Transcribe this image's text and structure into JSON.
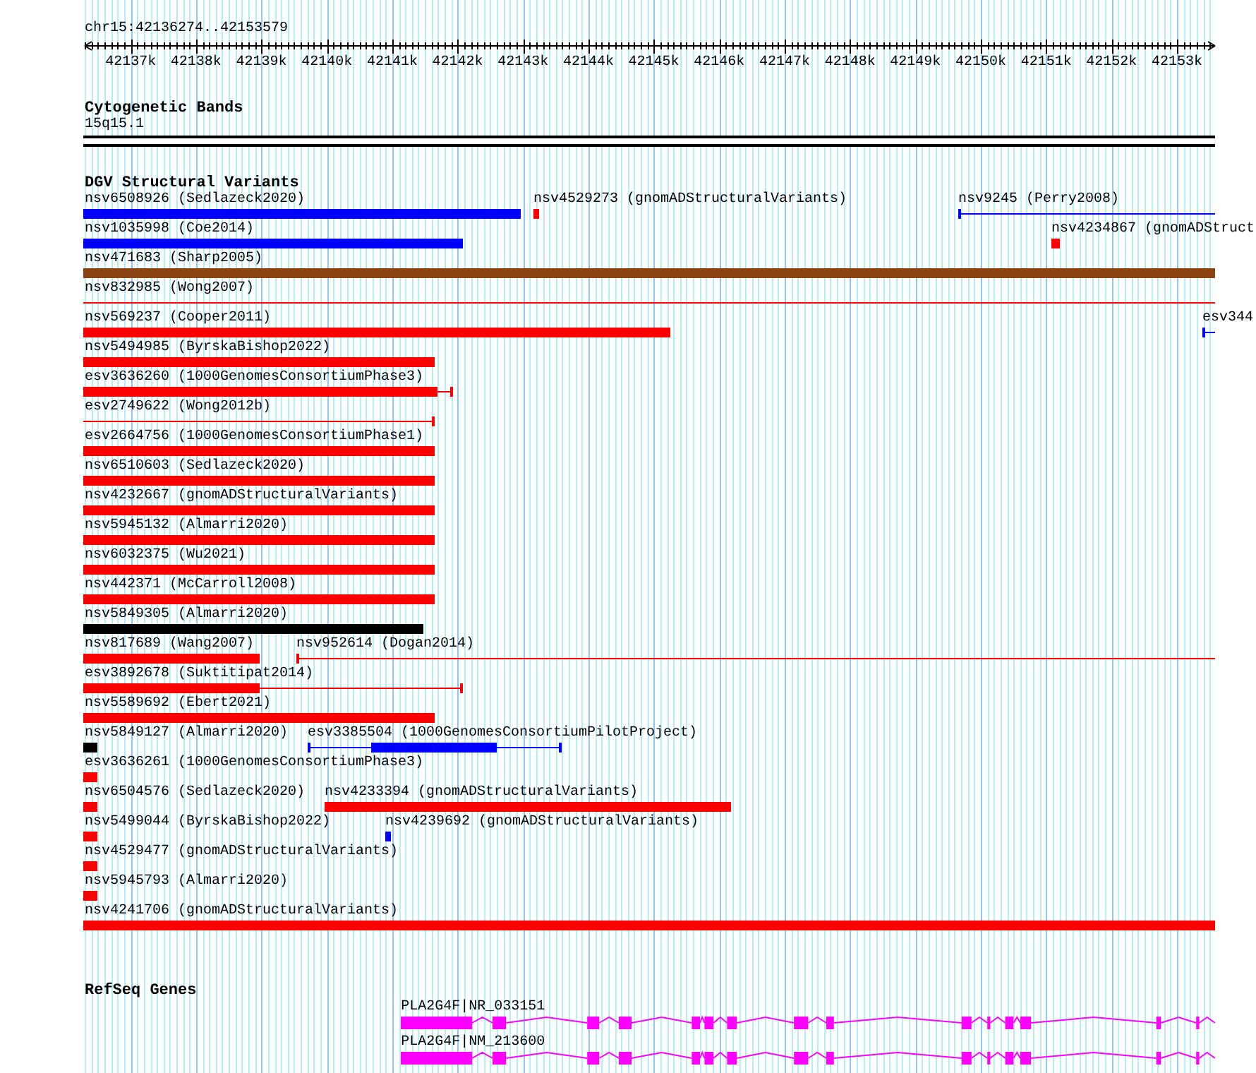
{
  "ruler": {
    "title": "chr15:42136274..42153579",
    "ticks": [
      {
        "label": "42137k"
      },
      {
        "label": "42138k"
      },
      {
        "label": "42139k"
      },
      {
        "label": "42140k"
      },
      {
        "label": "42141k"
      },
      {
        "label": "42142k"
      },
      {
        "label": "42143k"
      },
      {
        "label": "42144k"
      },
      {
        "label": "42145k"
      },
      {
        "label": "42146k"
      },
      {
        "label": "42147k"
      },
      {
        "label": "42148k"
      },
      {
        "label": "42149k"
      },
      {
        "label": "42150k"
      },
      {
        "label": "42151k"
      },
      {
        "label": "42152k"
      },
      {
        "label": "42153k"
      }
    ]
  },
  "tracks": [
    {
      "kind": "cytoband",
      "title": "Cytogenetic Bands",
      "bands": [
        {
          "label": "15q15.1"
        }
      ]
    },
    {
      "kind": "variants",
      "title": "DGV Structural Variants",
      "rows": [
        {
          "features": [
            {
              "label": "nsv6508926 (Sedlazeck2020)",
              "kind": "block",
              "color": "#0000ff"
            },
            {
              "label": "nsv4529273 (gnomADStructuralVariants)",
              "kind": "block",
              "color": "#ff0000"
            },
            {
              "label": "nsv9245 (Perry2008)",
              "kind": "line",
              "color": "#0000ff"
            }
          ]
        },
        {
          "features": [
            {
              "label": "nsv1035998 (Coe2014)",
              "kind": "block",
              "color": "#0000ff"
            },
            {
              "label": "nsv4234867 (gnomADStruct",
              "kind": "block",
              "color": "#ff0000"
            }
          ]
        },
        {
          "features": [
            {
              "label": "nsv471683 (Sharp2005)",
              "kind": "block",
              "color": "#8b4513"
            }
          ]
        },
        {
          "features": [
            {
              "label": "nsv832985 (Wong2007)",
              "kind": "line",
              "color": "#ff0000"
            }
          ]
        },
        {
          "features": [
            {
              "label": "nsv569237 (Cooper2011)",
              "kind": "block",
              "color": "#ff0000"
            },
            {
              "label": "esv344",
              "kind": "line",
              "color": "#0000ff"
            }
          ]
        },
        {
          "features": [
            {
              "label": "nsv5494985 (ByrskaBishop2022)",
              "kind": "block",
              "color": "#ff0000"
            }
          ]
        },
        {
          "features": [
            {
              "label": "esv3636260 (1000GenomesConsortiumPhase3)",
              "kind": "mixed",
              "color": "#ff0000"
            }
          ]
        },
        {
          "features": [
            {
              "label": "esv2749622 (Wong2012b)",
              "kind": "line",
              "color": "#ff0000"
            }
          ]
        },
        {
          "features": [
            {
              "label": "esv2664756 (1000GenomesConsortiumPhase1)",
              "kind": "block",
              "color": "#ff0000"
            }
          ]
        },
        {
          "features": [
            {
              "label": "nsv6510603 (Sedlazeck2020)",
              "kind": "block",
              "color": "#ff0000"
            }
          ]
        },
        {
          "features": [
            {
              "label": "nsv4232667 (gnomADStructuralVariants)",
              "kind": "block",
              "color": "#ff0000"
            }
          ]
        },
        {
          "features": [
            {
              "label": "nsv5945132 (Almarri2020)",
              "kind": "block",
              "color": "#ff0000"
            }
          ]
        },
        {
          "features": [
            {
              "label": "nsv6032375 (Wu2021)",
              "kind": "block",
              "color": "#ff0000"
            }
          ]
        },
        {
          "features": [
            {
              "label": "nsv442371 (McCarroll2008)",
              "kind": "block",
              "color": "#ff0000"
            }
          ]
        },
        {
          "features": [
            {
              "label": "nsv5849305 (Almarri2020)",
              "kind": "block",
              "color": "#000000"
            }
          ]
        },
        {
          "features": [
            {
              "label": "nsv817689 (Wang2007)",
              "kind": "block",
              "color": "#ff0000"
            },
            {
              "label": "nsv952614 (Dogan2014)",
              "kind": "line",
              "color": "#ff0000"
            }
          ]
        },
        {
          "features": [
            {
              "label": "esv3892678 (Suktitipat2014)",
              "kind": "mixed",
              "color": "#ff0000"
            }
          ]
        },
        {
          "features": [
            {
              "label": "nsv5589692 (Ebert2021)",
              "kind": "block",
              "color": "#ff0000"
            }
          ]
        },
        {
          "features": [
            {
              "label": "nsv5849127 (Almarri2020)",
              "kind": "block",
              "color": "#000000"
            },
            {
              "label": "esv3385504 (1000GenomesConsortiumPilotProject)",
              "kind": "mixed",
              "color": "#0000ff"
            }
          ]
        },
        {
          "features": [
            {
              "label": "esv3636261 (1000GenomesConsortiumPhase3)",
              "kind": "block",
              "color": "#ff0000"
            }
          ]
        },
        {
          "features": [
            {
              "label": "nsv6504576 (Sedlazeck2020)",
              "kind": "block",
              "color": "#ff0000"
            },
            {
              "label": "nsv4233394 (gnomADStructuralVariants)",
              "kind": "block",
              "color": "#ff0000"
            }
          ]
        },
        {
          "features": [
            {
              "label": "nsv5499044 (ByrskaBishop2022)",
              "kind": "block",
              "color": "#ff0000"
            },
            {
              "label": "nsv4239692 (gnomADStructuralVariants)",
              "kind": "block",
              "color": "#0000ff"
            }
          ]
        },
        {
          "features": [
            {
              "label": "nsv4529477 (gnomADStructuralVariants)",
              "kind": "block",
              "color": "#ff0000"
            }
          ]
        },
        {
          "features": [
            {
              "label": "nsv5945793 (Almarri2020)",
              "kind": "block",
              "color": "#ff0000"
            }
          ]
        },
        {
          "features": [
            {
              "label": "nsv4241706 (gnomADStructuralVariants)",
              "kind": "block",
              "color": "#ff0000"
            }
          ]
        }
      ]
    },
    {
      "kind": "genes",
      "title": "RefSeq Genes",
      "transcripts": [
        {
          "label": "PLA2G4F|NR_033151"
        },
        {
          "label": "PLA2G4F|NM_213600"
        }
      ]
    }
  ]
}
